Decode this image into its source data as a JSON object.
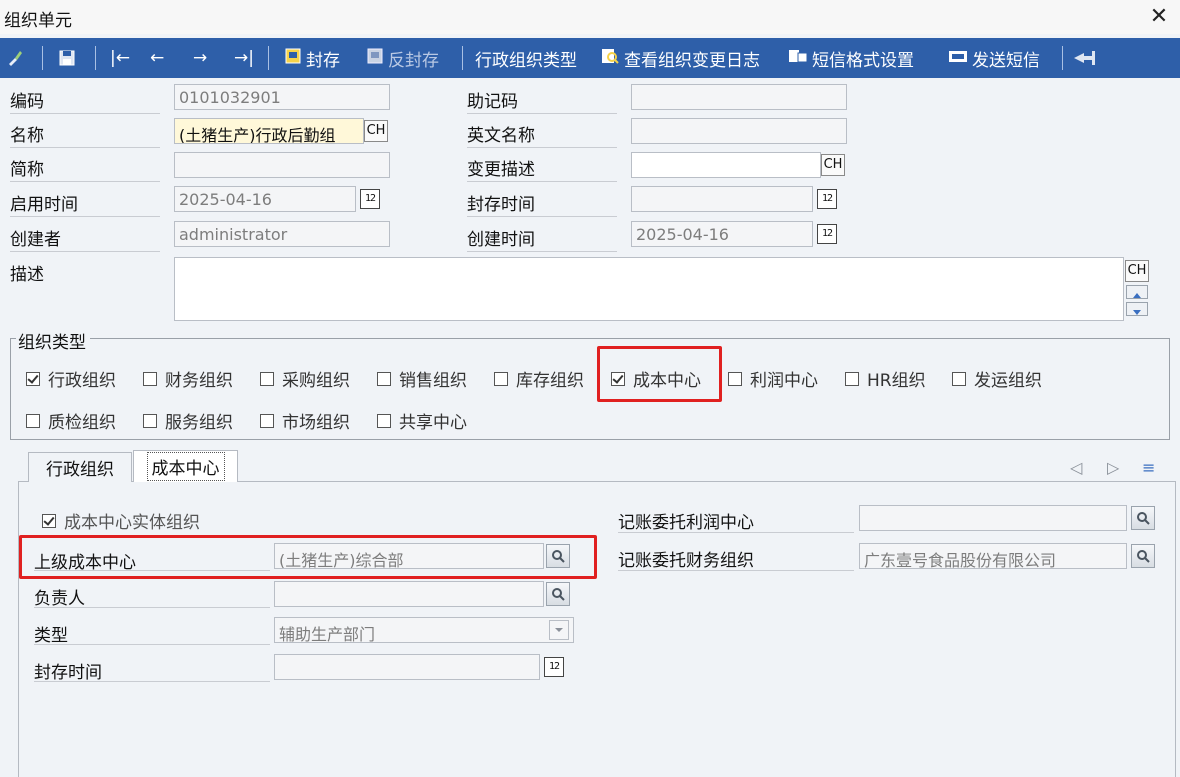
{
  "window": {
    "title": "组织单元",
    "close_glyph": "✕"
  },
  "toolbar": {
    "items": [
      {
        "id": "brush",
        "icon": "brush-icon"
      },
      {
        "id": "save",
        "icon": "save-icon"
      },
      {
        "id": "first",
        "glyph": "|←"
      },
      {
        "id": "prev",
        "glyph": "←"
      },
      {
        "id": "next",
        "glyph": "→"
      },
      {
        "id": "last",
        "glyph": "→|"
      }
    ],
    "archive_label": "封存",
    "unarchive_label": "反封存",
    "org_type_label": "行政组织类型",
    "change_log_label": "查看组织变更日志",
    "sms_format_label": "短信格式设置",
    "send_sms_label": "发送短信"
  },
  "form": {
    "code_label": "编码",
    "code_value": "0101032901",
    "mnemonic_label": "助记码",
    "mnemonic_value": "",
    "name_label": "名称",
    "name_value": "(土猪生产)行政后勤组",
    "english_name_label": "英文名称",
    "english_name_value": "",
    "short_name_label": "简称",
    "short_name_value": "",
    "change_desc_label": "变更描述",
    "change_desc_value": "",
    "enable_time_label": "启用时间",
    "enable_time_value": "2025-04-16",
    "archive_time_label": "封存时间",
    "archive_time_value": "",
    "creator_label": "创建者",
    "creator_value": "administrator",
    "create_time_label": "创建时间",
    "create_time_value": "2025-04-16",
    "description_label": "描述",
    "description_value": "",
    "ch_label": "CH",
    "cal_glyph": "12"
  },
  "org_types": {
    "title": "组织类型",
    "items": [
      {
        "label": "行政组织",
        "checked": true
      },
      {
        "label": "财务组织",
        "checked": false
      },
      {
        "label": "采购组织",
        "checked": false
      },
      {
        "label": "销售组织",
        "checked": false
      },
      {
        "label": "库存组织",
        "checked": false
      },
      {
        "label": "成本中心",
        "checked": true
      },
      {
        "label": "利润中心",
        "checked": false
      },
      {
        "label": "HR组织",
        "checked": false
      },
      {
        "label": "发运组织",
        "checked": false
      },
      {
        "label": "质检组织",
        "checked": false
      },
      {
        "label": "服务组织",
        "checked": false
      },
      {
        "label": "市场组织",
        "checked": false
      },
      {
        "label": "共享中心",
        "checked": false
      }
    ]
  },
  "tabs": [
    {
      "label": "行政组织",
      "active": false
    },
    {
      "label": "成本中心",
      "active": true
    }
  ],
  "tab_nav": {
    "prev": "◁",
    "next": "▷",
    "menu": "≡"
  },
  "cost_center": {
    "entity_label": "成本中心实体组织",
    "entity_checked": true,
    "parent_label": "上级成本中心",
    "parent_value": "(土猪生产)综合部",
    "manager_label": "负责人",
    "manager_value": "",
    "type_label": "类型",
    "type_value": "辅助生产部门",
    "archive_time_label": "封存时间",
    "archive_time_value": "",
    "profit_center_label": "记账委托利润中心",
    "profit_center_value": "",
    "finance_org_label": "记账委托财务组织",
    "finance_org_value": "广东壹号食品股份有限公司"
  },
  "colors": {
    "toolbar_bg": "#2e5fa9",
    "highlight": "#e02020",
    "name_field_bg": "#fff8d9"
  }
}
